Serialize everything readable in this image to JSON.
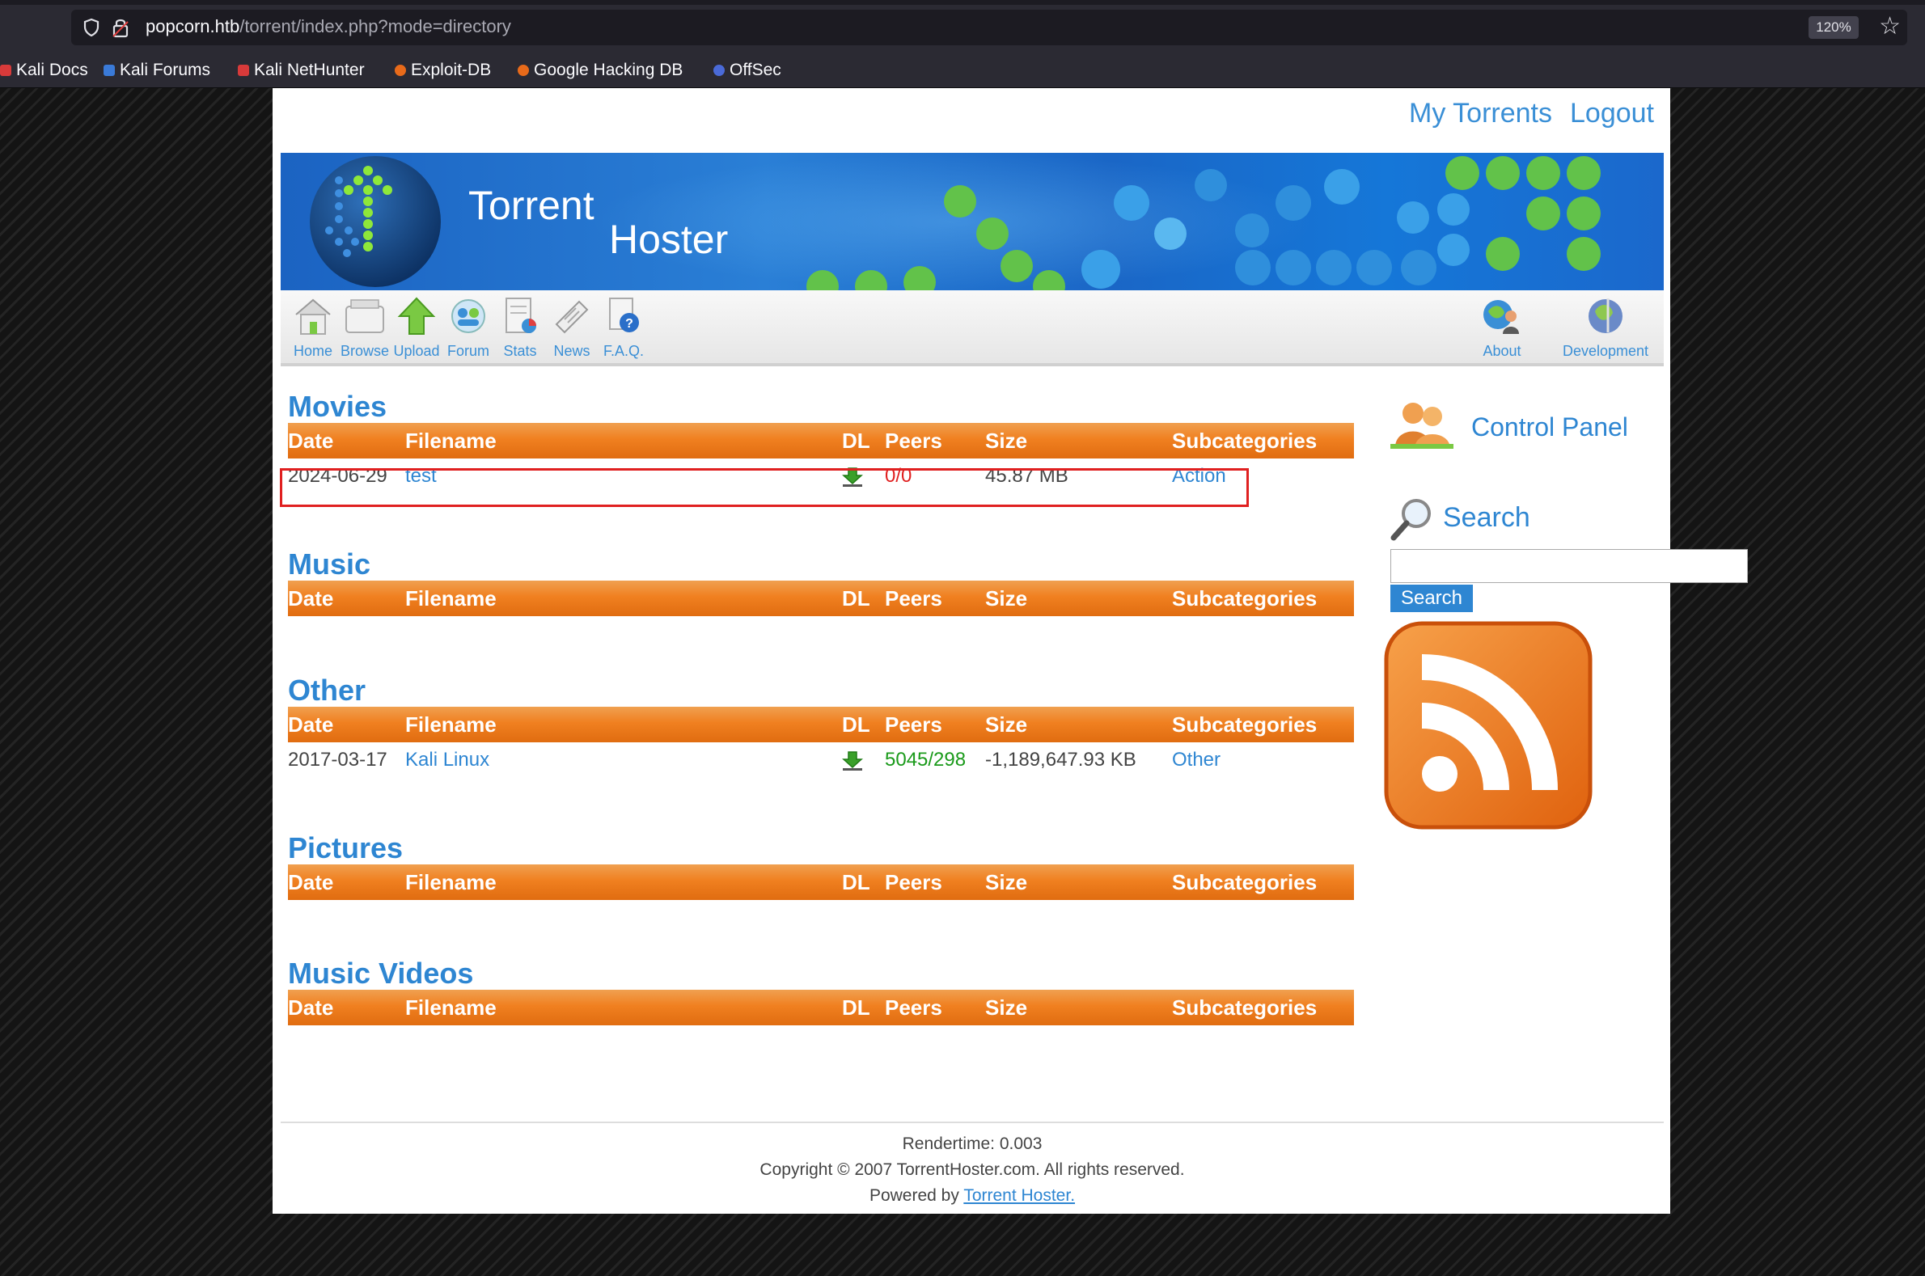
{
  "browser": {
    "url_host": "popcorn.htb",
    "url_path": "/torrent/index.php?mode=directory",
    "zoom": "120%",
    "bookmarks": [
      {
        "label": "Kali Docs",
        "color": "#d83a3a"
      },
      {
        "label": "Kali Forums",
        "color": "#3a7ad8"
      },
      {
        "label": "Kali NetHunter",
        "color": "#d83a3a"
      },
      {
        "label": "Exploit-DB",
        "color": "#e86a1a"
      },
      {
        "label": "Google Hacking DB",
        "color": "#e86a1a"
      },
      {
        "label": "OffSec",
        "color": "#4a6ad8"
      }
    ]
  },
  "header": {
    "links": [
      "My Torrents",
      "Logout"
    ],
    "logo_line1": "Torrent",
    "logo_line2": "Hoster"
  },
  "nav": {
    "left": [
      "Home",
      "Browse",
      "Upload",
      "Forum",
      "Stats",
      "News",
      "F.A.Q."
    ],
    "right": [
      "About",
      "Development"
    ]
  },
  "table_columns": [
    "Date",
    "Filename",
    "DL",
    "Peers",
    "Size",
    "Subcategories"
  ],
  "sections": [
    {
      "title": "Movies",
      "rows": [
        {
          "date": "2024-06-29",
          "filename": "test",
          "peers": "0/0",
          "peers_color": "#e02020",
          "size": "45.87 MB",
          "subcategory": "Action"
        }
      ]
    },
    {
      "title": "Music",
      "rows": []
    },
    {
      "title": "Other",
      "rows": [
        {
          "date": "2017-03-17",
          "filename": "Kali Linux",
          "peers": "5045/298",
          "peers_color": "#1a9a1a",
          "size": "-1,189,647.93 KB",
          "subcategory": "Other"
        }
      ]
    },
    {
      "title": "Pictures",
      "rows": []
    },
    {
      "title": "Music Videos",
      "rows": []
    }
  ],
  "sidebar": {
    "control_panel": "Control Panel",
    "search_title": "Search",
    "search_button": "Search",
    "search_value": ""
  },
  "footer": {
    "rendertime": "Rendertime: 0.003",
    "copyright": "Copyright © 2007 TorrentHoster.com. All rights reserved.",
    "powered_prefix": "Powered by ",
    "powered_link": "Torrent Hoster."
  },
  "colors": {
    "accent": "#2e86d2",
    "table_header": "#f08020",
    "highlight": "#e02020"
  }
}
